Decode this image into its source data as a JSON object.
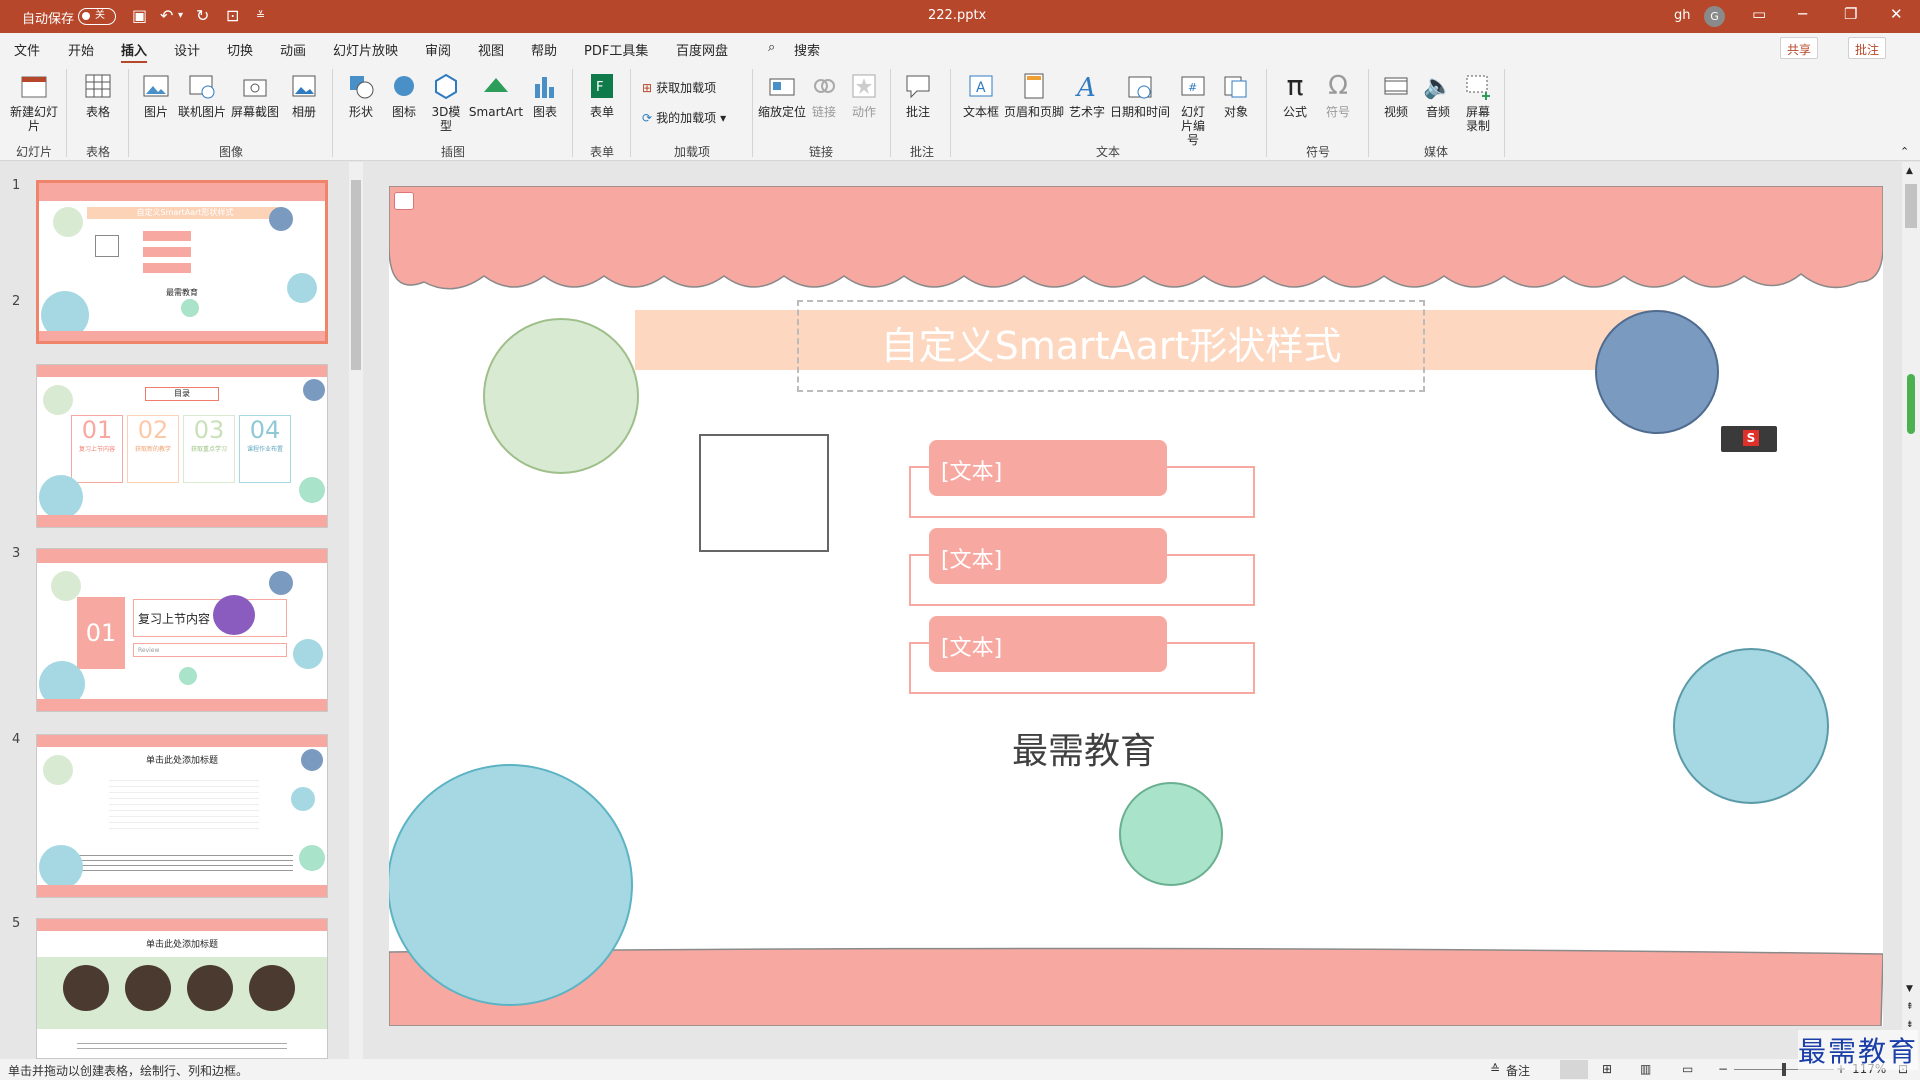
{
  "titlebar": {
    "autosave": "自动保存",
    "toggle_state": "关",
    "filename": "222.pptx",
    "user": "gh",
    "avatar_letter": "G"
  },
  "tabs": [
    "文件",
    "开始",
    "插入",
    "设计",
    "切换",
    "动画",
    "幻灯片放映",
    "审阅",
    "视图",
    "帮助",
    "PDF工具集",
    "百度网盘"
  ],
  "search_label": "搜索",
  "share_label": "共享",
  "comment_label": "批注",
  "ribbon": {
    "new_slide": "新建幻灯片",
    "table": "表格",
    "picture": "图片",
    "online_picture": "联机图片",
    "screenshot": "屏幕截图",
    "album": "相册",
    "shapes": "形状",
    "icons": "图标",
    "model3d": "3D模型",
    "smartart": "SmartArt",
    "chart": "图表",
    "form": "表单",
    "get_addins": "获取加载项",
    "my_addins": "我的加载项",
    "zoom": "缩放定位",
    "link": "链接",
    "action": "动作",
    "comment": "批注",
    "textbox": "文本框",
    "header_footer": "页眉和页脚",
    "wordart": "艺术字",
    "datetime": "日期和时间",
    "slide_number": "幻灯片编号",
    "object": "对象",
    "equation": "公式",
    "symbol": "符号",
    "video": "视频",
    "audio": "音频",
    "screen_record": "屏幕录制",
    "groups": {
      "slides": "幻灯片",
      "tables": "表格",
      "images": "图像",
      "illustrations": "插图",
      "forms": "表单",
      "addins": "加载项",
      "links": "链接",
      "comments": "批注",
      "text": "文本",
      "symbols": "符号",
      "media": "媒体"
    }
  },
  "slides": [
    {
      "num": "1",
      "title": "自定义SmartAart形状样式",
      "footer": "最需教育"
    },
    {
      "num": "2",
      "title": "目录",
      "items": [
        "01",
        "02",
        "03",
        "04"
      ],
      "captions": [
        "复习上节内容",
        "获取新的教学",
        "获取重点学习",
        "课程作业布置"
      ]
    },
    {
      "num": "3",
      "number": "01",
      "title": "复习上节内容",
      "sub": "Review"
    },
    {
      "num": "4",
      "title": "单击此处添加标题"
    },
    {
      "num": "5",
      "title": "单击此处添加标题"
    }
  ],
  "main_slide": {
    "title": "自定义SmartAart形状样式",
    "items": [
      "[文本]",
      "[文本]",
      "[文本]"
    ],
    "footer": "最需教育"
  },
  "status": {
    "hint": "单击并拖动以创建表格，绘制行、列和边框。",
    "notes": "备注",
    "zoom": "117%"
  },
  "watermark": "最需教育"
}
